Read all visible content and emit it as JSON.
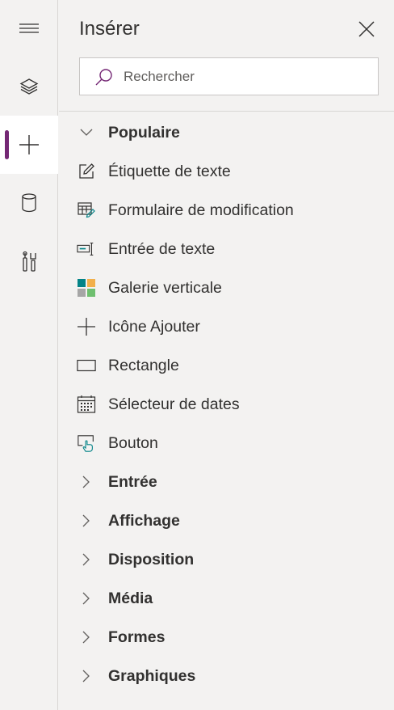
{
  "panel": {
    "title": "Insérer"
  },
  "search": {
    "placeholder": "Rechercher"
  },
  "rail": [
    {
      "icon": "hamburger-icon"
    },
    {
      "icon": "layers-icon"
    },
    {
      "icon": "add-icon",
      "active": true
    },
    {
      "icon": "database-icon"
    },
    {
      "icon": "tools-icon"
    }
  ],
  "popular": {
    "label": "Populaire",
    "items": [
      {
        "label": "Étiquette de texte",
        "icon": "text-label-icon"
      },
      {
        "label": "Formulaire de modification",
        "icon": "edit-form-icon"
      },
      {
        "label": "Entrée de texte",
        "icon": "text-input-icon"
      },
      {
        "label": "Galerie verticale",
        "icon": "gallery-icon"
      },
      {
        "label": "Icône Ajouter",
        "icon": "add-icon"
      },
      {
        "label": "Rectangle",
        "icon": "rectangle-icon"
      },
      {
        "label": "Sélecteur de dates",
        "icon": "calendar-icon"
      },
      {
        "label": "Bouton",
        "icon": "button-icon"
      }
    ]
  },
  "categories": [
    {
      "label": "Entrée"
    },
    {
      "label": "Affichage"
    },
    {
      "label": "Disposition"
    },
    {
      "label": "Média"
    },
    {
      "label": "Formes"
    },
    {
      "label": "Graphiques"
    }
  ],
  "colors": {
    "accent": "#742774",
    "teal": "#038387"
  }
}
